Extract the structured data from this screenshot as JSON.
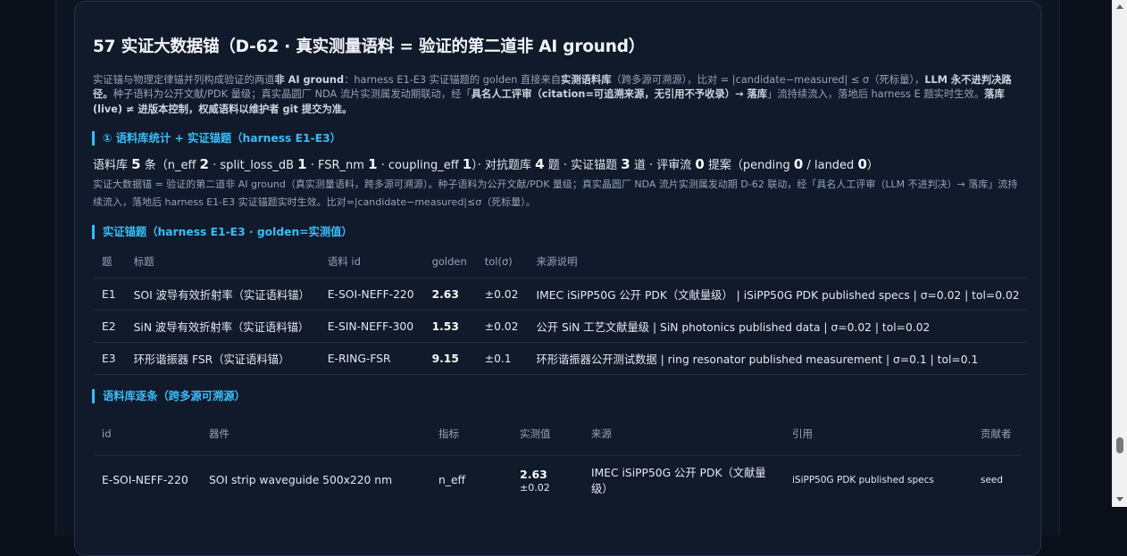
{
  "section": {
    "title": "57 实证大数据锚（D-62 · 真实测量语料 = 验证的第二道非 AI ground）",
    "intro": [
      {
        "t": "实证锚与物理定律锚并列构成验证的两道",
        "b": false
      },
      {
        "t": "非 AI ground",
        "b": true
      },
      {
        "t": "：harness E1-E3 实证锚题的 golden 直接来自",
        "b": false
      },
      {
        "t": "实测语料库",
        "b": true
      },
      {
        "t": "（跨多源可溯源），比对 = |candidate−measured| ≤ σ（死标量），",
        "b": false
      },
      {
        "t": "LLM 永不进判决路径。",
        "b": true
      },
      {
        "t": "种子语料为公开文献/PDK 量级；真实晶圆厂 NDA 流片实测属发动期联动，经「",
        "b": false
      },
      {
        "t": "具名人工评审（citation=可追溯来源，无引用不予收录）→ 落库",
        "b": true
      },
      {
        "t": "」流持续流入，落地后 harness E 题实时生效。",
        "b": false
      },
      {
        "t": "落库(live) ≠ 进版本控制，权威语料以维护者 git 提交为准。",
        "b": true
      }
    ]
  },
  "stats_section": {
    "heading": "① 语料库统计 + 实证锚题（harness E1-E3）",
    "parts": [
      {
        "t": "语料库 ",
        "n": false
      },
      {
        "t": "5",
        "n": true
      },
      {
        "t": " 条（n_eff ",
        "n": false
      },
      {
        "t": "2",
        "n": true
      },
      {
        "t": " · split_loss_dB ",
        "n": false
      },
      {
        "t": "1",
        "n": true
      },
      {
        "t": " · FSR_nm ",
        "n": false
      },
      {
        "t": "1",
        "n": true
      },
      {
        "t": " · coupling_eff ",
        "n": false
      },
      {
        "t": "1",
        "n": true
      },
      {
        "t": "）· 对抗题库 ",
        "n": false
      },
      {
        "t": "4",
        "n": true
      },
      {
        "t": " 题 · 实证锚题 ",
        "n": false
      },
      {
        "t": "3",
        "n": true
      },
      {
        "t": " 道 · 评审流 ",
        "n": false
      },
      {
        "t": "0",
        "n": true
      },
      {
        "t": " 提案（pending ",
        "n": false
      },
      {
        "t": "0",
        "n": true
      },
      {
        "t": " / landed ",
        "n": false
      },
      {
        "t": "0",
        "n": true
      },
      {
        "t": "）",
        "n": false
      }
    ],
    "note": "实证大数据锚 = 验证的第二道非 AI ground（真实测量语料，跨多源可溯源）。种子语料为公开文献/PDK 量级；真实晶圆厂 NDA 流片实测属发动期 D-62 联动，经「具名人工评审（LLM 不进判决）→ 落库」流持续流入，落地后 harness E1-E3 实证锚题实时生效。比对=|candidate−measured|≤σ（死标量）。"
  },
  "anchor_section": {
    "heading": "实证锚题（harness E1-E3 · golden=实测值）",
    "columns": [
      "题",
      "标题",
      "语料 id",
      "golden",
      "tol(σ)",
      "来源说明"
    ],
    "rows": [
      [
        "E1",
        "SOI 波导有效折射率（实证语料锚）",
        "E-SOI-NEFF-220",
        "2.63",
        "±0.02",
        "IMEC iSiPP50G 公开 PDK（文献量级） | iSiPP50G PDK published specs | σ=0.02 | tol=0.02"
      ],
      [
        "E2",
        "SiN 波导有效折射率（实证语料锚）",
        "E-SIN-NEFF-300",
        "1.53",
        "±0.02",
        "公开 SiN 工艺文献量级 | SiN photonics published data | σ=0.02 | tol=0.02"
      ],
      [
        "E3",
        "环形谐振器 FSR（实证语料锚）",
        "E-RING-FSR",
        "9.15",
        "±0.1",
        "环形谐振器公开测试数据 | ring resonator published measurement | σ=0.1 | tol=0.1"
      ]
    ]
  },
  "corpus_section": {
    "heading": "语料库逐条（跨多源可溯源）",
    "columns": [
      "id",
      "器件",
      "指标",
      "实测值",
      "来源",
      "引用",
      "贡献者"
    ],
    "rows": [
      {
        "id": "E-SOI-NEFF-220",
        "device": "SOI strip waveguide 500x220 nm",
        "metric": "n_eff",
        "value": "2.63",
        "sigma": "±0.02",
        "source": "IMEC iSiPP50G 公开 PDK（文献量级）",
        "citation": "iSiPP50G PDK published specs",
        "contributor": "seed"
      }
    ]
  }
}
